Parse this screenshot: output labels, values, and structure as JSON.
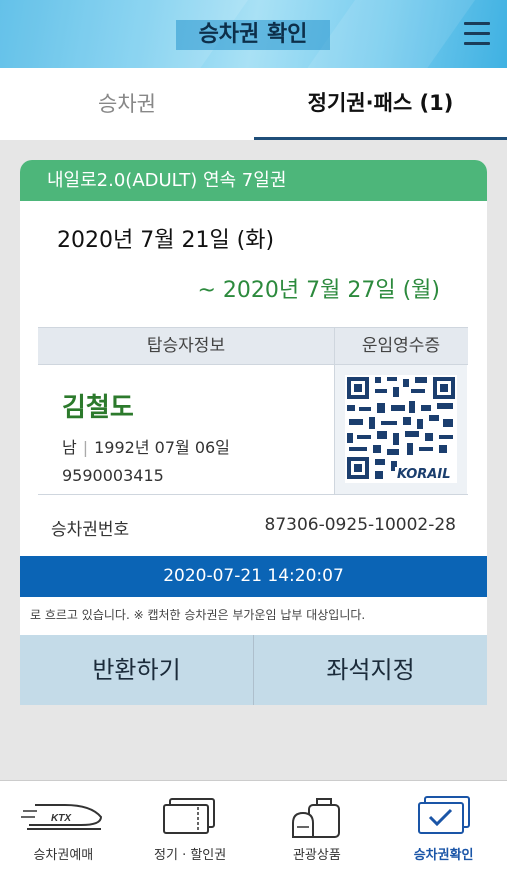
{
  "header": {
    "title": "승차권 확인",
    "menu_icon": "hamburger-menu-icon"
  },
  "tabs": [
    {
      "label": "승차권",
      "active": false
    },
    {
      "label": "정기권·패스 (1)",
      "active": true
    }
  ],
  "ticket": {
    "product": "내일로2.0(ADULT) 연속 7일권",
    "date_from": "2020년 7월 21일 (화)",
    "date_to": "~ 2020년 7월 27일 (월)",
    "passenger_header": "탑승자정보",
    "receipt_header": "운임영수증",
    "passenger_name": "김철도",
    "gender": "남",
    "birth": "1992년 07월 06일",
    "passenger_id": "9590003415",
    "qr_logo": "KORAIL",
    "ticket_no_label": "승차권번호",
    "ticket_no": "87306-0925-10002-28",
    "timestamp": "2020-07-21 14:20:07",
    "notice": "로 흐르고 있습니다. ※ 캡처한 승차권은 부가운임 납부 대상입니다.",
    "refund_button": "반환하기",
    "seat_button": "좌석지정"
  },
  "colors": {
    "header_green": "#4db67a",
    "timebar_blue": "#0b64b5",
    "button_bg": "#c4dbe8",
    "active_nav": "#1a55a7"
  },
  "bottom_nav": [
    {
      "label": "승차권예매",
      "icon": "ktx-train-icon"
    },
    {
      "label": "정기 · 할인권",
      "icon": "pass-cards-icon"
    },
    {
      "label": "관광상품",
      "icon": "luggage-icon"
    },
    {
      "label": "승차권확인",
      "icon": "ticket-check-icon",
      "active": true
    }
  ]
}
